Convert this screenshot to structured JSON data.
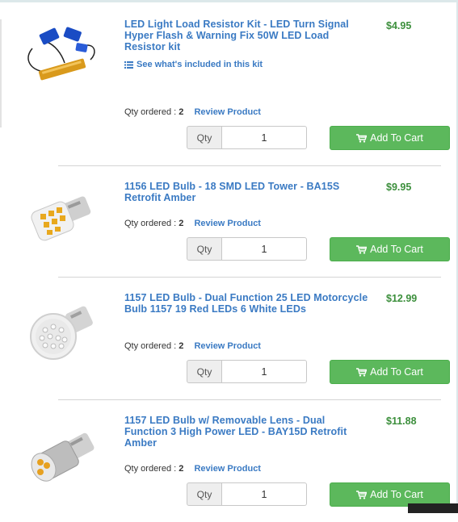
{
  "items": [
    {
      "title": "LED Light Load Resistor Kit - LED Turn Signal Hyper Flash & Warning Fix 50W LED Load Resistor kit",
      "price": "$4.95",
      "kit_link": "See what's included in this kit",
      "qty_ordered_label": "Qty ordered :",
      "qty_ordered": "2",
      "review_label": "Review Product",
      "qty_label": "Qty",
      "qty_value": "1",
      "cart_label": "Add To Cart"
    },
    {
      "title": "1156 LED Bulb - 18 SMD LED Tower - BA15S Retrofit Amber",
      "price": "$9.95",
      "qty_ordered_label": "Qty ordered :",
      "qty_ordered": "2",
      "review_label": "Review Product",
      "qty_label": "Qty",
      "qty_value": "1",
      "cart_label": "Add To Cart"
    },
    {
      "title": "1157 LED Bulb - Dual Function 25 LED Motorcycle Bulb 1157 19 Red LEDs 6 White LEDs",
      "price": "$12.99",
      "qty_ordered_label": "Qty ordered :",
      "qty_ordered": "2",
      "review_label": "Review Product",
      "qty_label": "Qty",
      "qty_value": "1",
      "cart_label": "Add To Cart"
    },
    {
      "title": "1157 LED Bulb w/ Removable Lens - Dual Function 3 High Power LED - BAY15D Retrofit Amber",
      "price": "$11.88",
      "qty_ordered_label": "Qty ordered :",
      "qty_ordered": "2",
      "review_label": "Review Product",
      "qty_label": "Qty",
      "qty_value": "1",
      "cart_label": "Add To Cart"
    }
  ],
  "colors": {
    "link_blue": "#3a7ac3",
    "price_green": "#3c8f3c",
    "button_green": "#5cb85c"
  },
  "icons": [
    "list-icon",
    "cart-icon"
  ]
}
